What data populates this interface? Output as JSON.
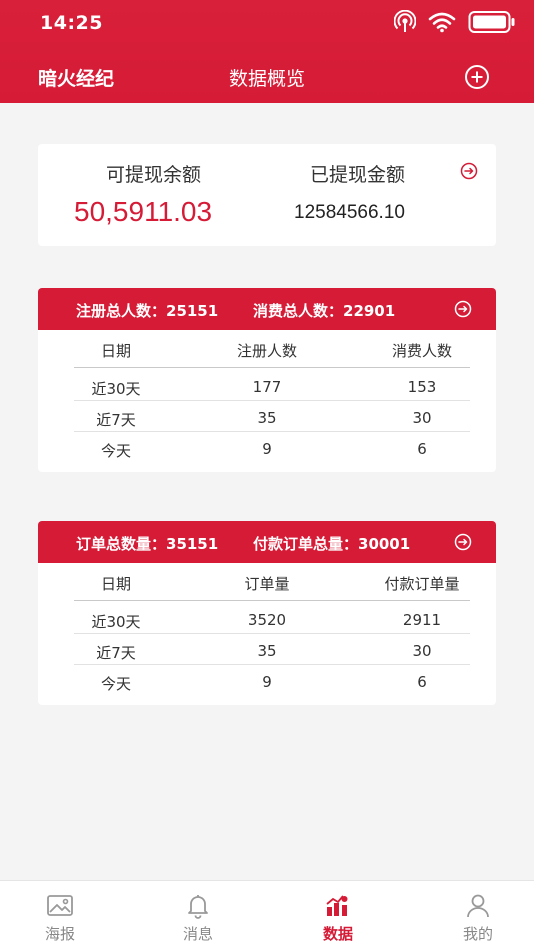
{
  "status": {
    "time": "14:25"
  },
  "header": {
    "brand": "暗火经纪",
    "title": "数据概览",
    "add_icon": "plus-circle-icon"
  },
  "balance": {
    "withdrawable_label": "可提现余额",
    "withdrawable_value": "50,5911.03",
    "withdrawn_label": "已提现金额",
    "withdrawn_value": "12584566.10"
  },
  "users": {
    "header_total_registered": "注册总人数：25151",
    "header_total_consumers": "消费总人数：22901",
    "columns": [
      "日期",
      "注册人数",
      "消费人数"
    ],
    "rows": [
      {
        "date": "近30天",
        "a": "177",
        "b": "153"
      },
      {
        "date": "近7天",
        "a": "35",
        "b": "30"
      },
      {
        "date": "今天",
        "a": "9",
        "b": "6"
      }
    ]
  },
  "orders": {
    "header_total_orders": "订单总数量：35151",
    "header_total_paid": "付款订单总量：30001",
    "columns": [
      "日期",
      "订单量",
      "付款订单量"
    ],
    "rows": [
      {
        "date": "近30天",
        "a": "3520",
        "b": "2911"
      },
      {
        "date": "近7天",
        "a": "35",
        "b": "30"
      },
      {
        "date": "今天",
        "a": "9",
        "b": "6"
      }
    ]
  },
  "tabs": [
    {
      "label": "海报",
      "icon": "poster-image-icon"
    },
    {
      "label": "消息",
      "icon": "bell-icon"
    },
    {
      "label": "数据",
      "icon": "data-chart-icon"
    },
    {
      "label": "我的",
      "icon": "user-icon"
    }
  ],
  "colors": {
    "accent": "#d51b36",
    "background": "#f4f4f4",
    "tab_inactive": "#888888"
  }
}
